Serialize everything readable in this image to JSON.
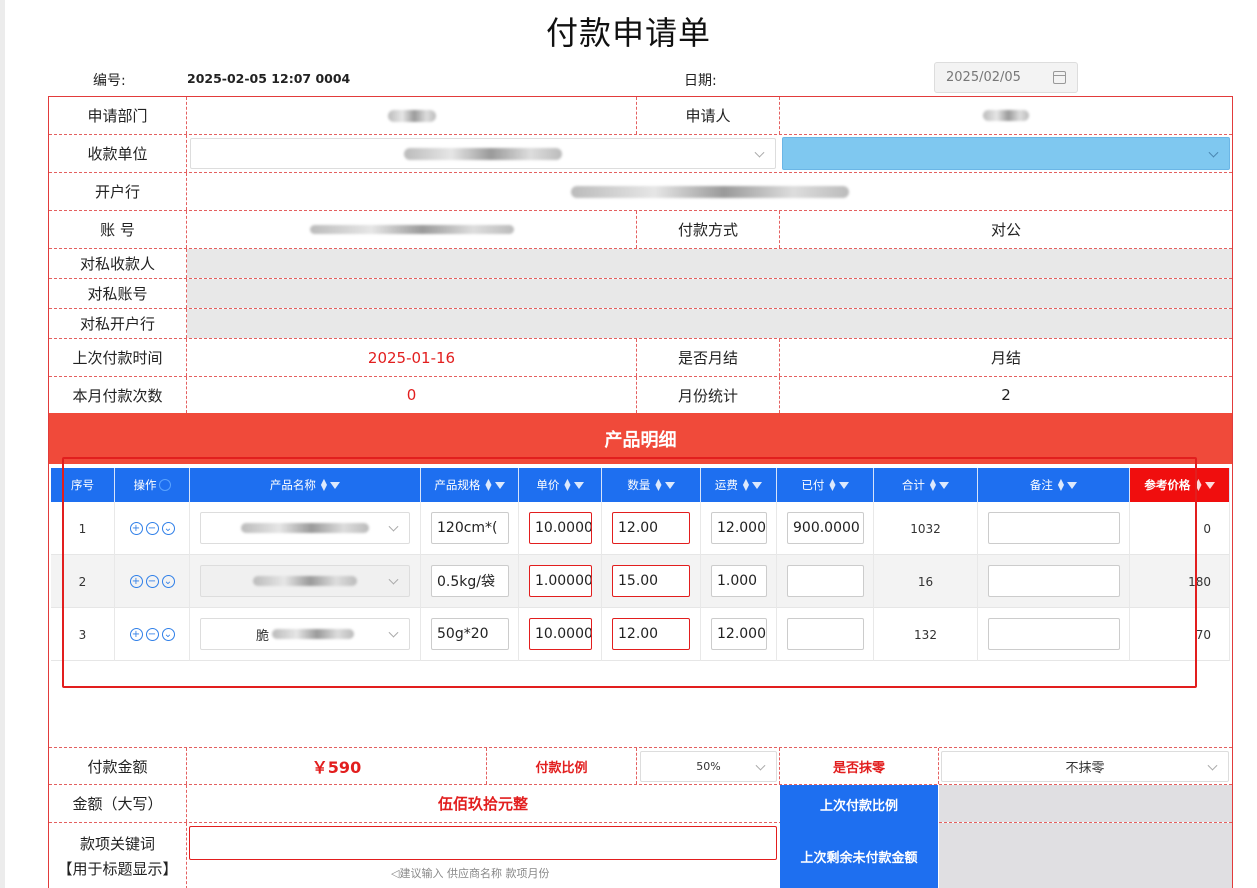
{
  "title": "付款申请单",
  "header": {
    "number_label": "编号:",
    "number_value": "2025-02-05 12:07 0004",
    "date_label": "日期:",
    "date_value": "2025/02/05"
  },
  "form": {
    "dept_label": "申请部门",
    "applicant_label": "申请人",
    "payee_label": "收款单位",
    "bank_label": "开户行",
    "account_label": "账 号",
    "pay_method_label": "付款方式",
    "pay_method_value": "对公",
    "private_payee_label": "对私收款人",
    "private_account_label": "对私账号",
    "private_bank_label": "对私开户行",
    "last_pay_time_label": "上次付款时间",
    "last_pay_time_value": "2025-01-16",
    "monthly_label": "是否月结",
    "monthly_value": "月结",
    "month_count_label": "本月付款次数",
    "month_count_value": "0",
    "month_stat_label": "月份统计",
    "month_stat_value": "2"
  },
  "section_title": "产品明细",
  "table": {
    "headers": [
      "序号",
      "操作",
      "产品名称",
      "产品规格",
      "单价",
      "数量",
      "运费",
      "已付",
      "合计",
      "备注",
      "参考价格"
    ],
    "rows": [
      {
        "no": "1",
        "spec": "120cm*(",
        "price": "10.00000",
        "qty": "12.00",
        "freight": "12.000",
        "paid": "900.0000",
        "total": "1032",
        "ref": "0",
        "name_prefix": ""
      },
      {
        "no": "2",
        "spec": "0.5kg/袋",
        "price": "1.00000",
        "qty": "15.00",
        "freight": "1.000",
        "paid": "",
        "total": "16",
        "ref": "180",
        "name_prefix": ""
      },
      {
        "no": "3",
        "spec": "50g*20",
        "price": "10.00000",
        "qty": "12.00",
        "freight": "12.000",
        "paid": "",
        "total": "132",
        "ref": "70",
        "name_prefix": "脆"
      }
    ]
  },
  "footer": {
    "amount_label": "付款金额",
    "amount_value": "￥590",
    "ratio_label": "付款比例",
    "ratio_value": "50%",
    "rounding_label": "是否抹零",
    "rounding_value": "不抹零",
    "amount_upper_label": "金额（大写）",
    "amount_upper_value": "伍佰玖拾元整",
    "last_ratio_label": "上次付款比例",
    "keyword_label": "款项关键词",
    "keyword_label2": "【用于标题显示】",
    "last_unpaid_label": "上次剩余未付款金额",
    "keyword_hint": "◁建议输入  供应商名称  款项月份"
  },
  "colors": {
    "accent_red": "#f04a3a",
    "header_blue": "#1e6ff0",
    "ref_red": "#f00e0e",
    "payee_select_blue": "#7fc8f0"
  }
}
